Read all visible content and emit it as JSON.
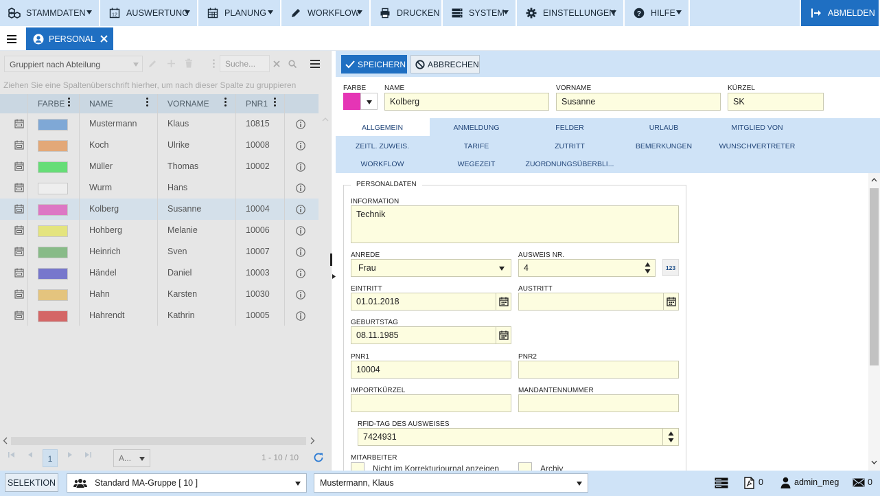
{
  "menu": {
    "items": [
      {
        "label": "STAMMDATEN",
        "icon": "cubes-icon"
      },
      {
        "label": "AUSWERTUNG",
        "icon": "calendar-12-icon",
        "icon_text": "12"
      },
      {
        "label": "PLANUNG",
        "icon": "calendar-grid-icon"
      },
      {
        "label": "WORKFLOW",
        "icon": "pencil-icon"
      },
      {
        "label": "DRUCKEN",
        "icon": "printer-icon"
      },
      {
        "label": "SYSTEM",
        "icon": "server-icon"
      },
      {
        "label": "EINSTELLUNGEN",
        "icon": "gear-icon"
      },
      {
        "label": "HILFE",
        "icon": "help-icon"
      }
    ],
    "logout": "ABMELDEN"
  },
  "tab": {
    "label": "PERSONAL"
  },
  "list": {
    "group_by": "Gruppiert nach Abteilung",
    "search_placeholder": "Suche...",
    "group_hint": "Ziehen Sie eine Spaltenüberschrift hierher, um nach dieser Spalte zu gruppieren",
    "columns": [
      "FARBE",
      "NAME",
      "VORNAME",
      "PNR1"
    ],
    "rows": [
      {
        "color": "#7fa8d6",
        "name": "Mustermann",
        "vorname": "Klaus",
        "pnr1": "10815"
      },
      {
        "color": "#e3a878",
        "name": "Koch",
        "vorname": "Ulrike",
        "pnr1": "10008"
      },
      {
        "color": "#66dd77",
        "name": "Müller",
        "vorname": "Thomas",
        "pnr1": "10002"
      },
      {
        "color": "#eeeeee",
        "name": "Wurm",
        "vorname": "Hans",
        "pnr1": ""
      },
      {
        "color": "#dd77c4",
        "name": "Kolberg",
        "vorname": "Susanne",
        "pnr1": "10004",
        "selected": true
      },
      {
        "color": "#e4e47e",
        "name": "Hohberg",
        "vorname": "Melanie",
        "pnr1": "10006"
      },
      {
        "color": "#88bb88",
        "name": "Heinrich",
        "vorname": "Sven",
        "pnr1": "10007"
      },
      {
        "color": "#7777cc",
        "name": "Händel",
        "vorname": "Daniel",
        "pnr1": "10003"
      },
      {
        "color": "#e4c47e",
        "name": "Hahn",
        "vorname": "Karsten",
        "pnr1": "10030"
      },
      {
        "color": "#d46666",
        "name": "Hahrendt",
        "vorname": "Kathrin",
        "pnr1": "10005"
      }
    ],
    "page_current": "1",
    "page_size_select": "A...",
    "page_count": "1 - 10 / 10"
  },
  "detail": {
    "save": "SPEICHERN",
    "cancel": "ABBRECHEN",
    "farbe_label": "FARBE",
    "farbe_value": "#e535b5",
    "name_label": "NAME",
    "name_value": "Kolberg",
    "vorname_label": "VORNAME",
    "vorname_value": "Susanne",
    "kuerzel_label": "KÜRZEL",
    "kuerzel_value": "SK",
    "tabs": [
      "ALLGEMEIN",
      "ANMELDUNG",
      "FELDER",
      "URLAUB",
      "MITGLIED VON",
      "ZEITL. ZUWEIS.",
      "TARIFE",
      "ZUTRITT",
      "BEMERKUNGEN",
      "WUNSCHVERTRETER",
      "WORKFLOW",
      "WEGEZEIT",
      "ZUORDNUNGSÜBERBLI..."
    ],
    "section": "PERSONALDATEN",
    "information_label": "INFORMATION",
    "information_value": "Technik",
    "anrede_label": "ANREDE",
    "anrede_value": "Frau",
    "ausweis_label": "AUSWEIS NR.",
    "ausweis_value": "4",
    "ausweis_btn": "123",
    "eintritt_label": "EINTRITT",
    "eintritt_value": "01.01.2018",
    "austritt_label": "AUSTRITT",
    "austritt_value": "",
    "geburtstag_label": "GEBURTSTAG",
    "geburtstag_value": "08.11.1985",
    "pnr1_label": "PNR1",
    "pnr1_value": "10004",
    "pnr2_label": "PNR2",
    "pnr2_value": "",
    "import_label": "IMPORTKÜRZEL",
    "import_value": "",
    "mandant_label": "MANDANTENNUMMER",
    "mandant_value": "",
    "rfid_label": "RFID-TAG DES AUSWEISES",
    "rfid_value": "7424931",
    "mitarbeiter_label": "MITARBEITER",
    "check1": "Nicht im Korrekturjournal anzeigen",
    "check2": "Archiv"
  },
  "status": {
    "selektion": "SELEKTION",
    "group": "Standard MA-Gruppe   [ 10 ]",
    "person": "Mustermann, Klaus",
    "pdf_count": "0",
    "user": "admin_meg",
    "mail_count": "0"
  }
}
